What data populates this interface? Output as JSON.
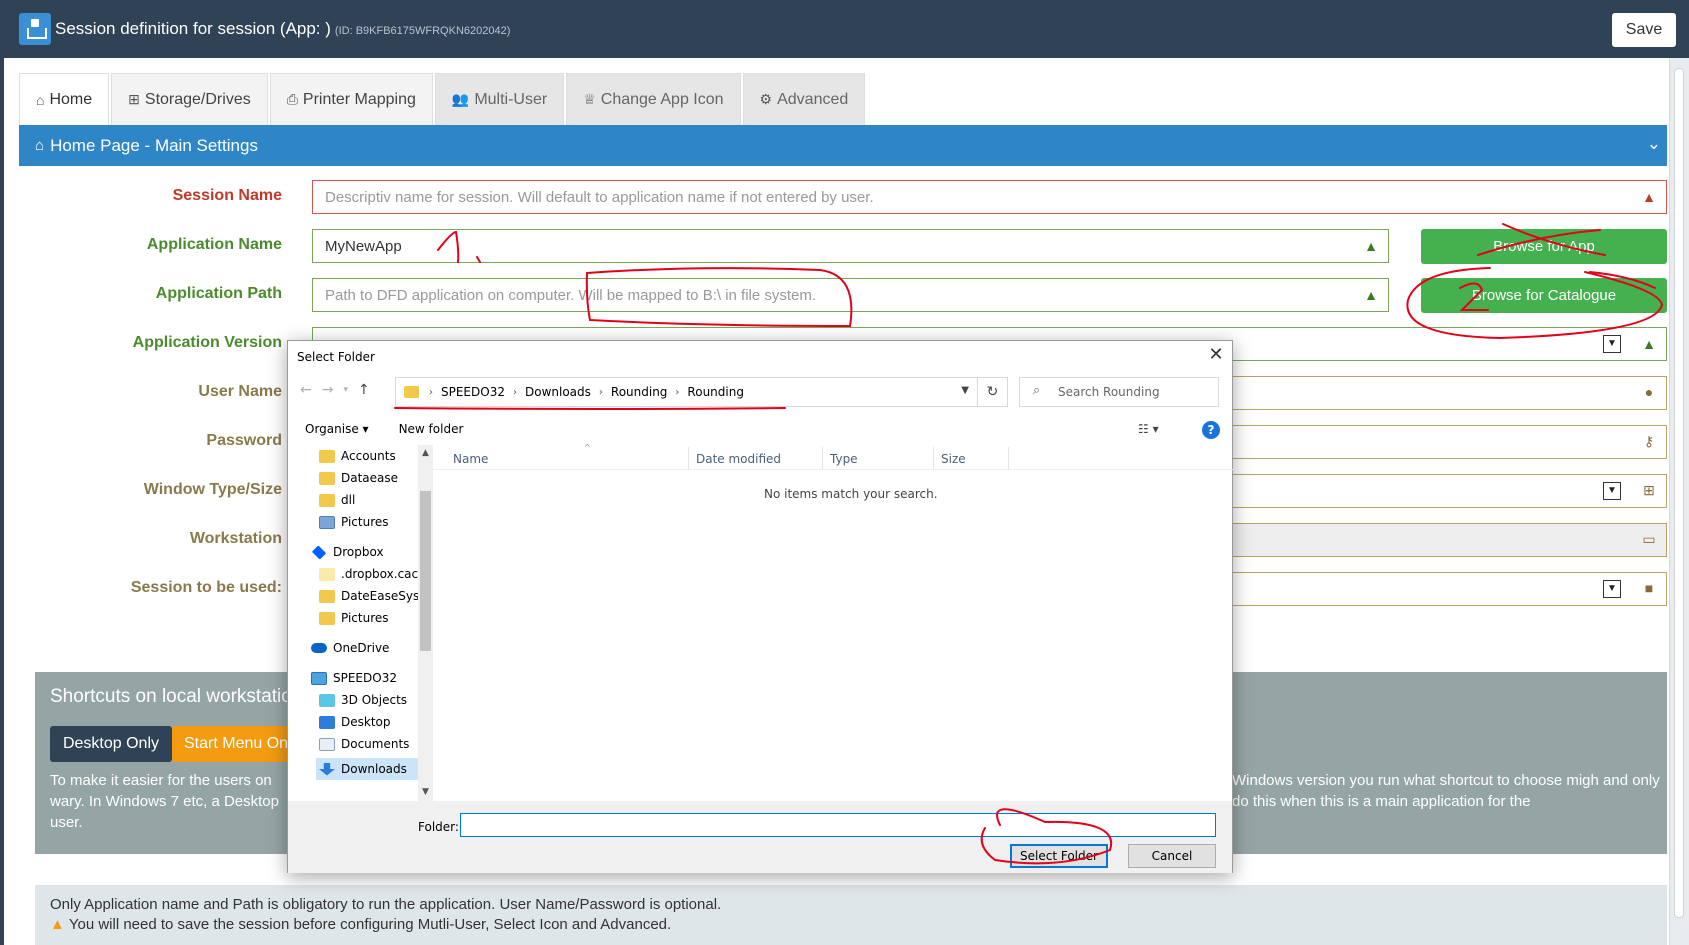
{
  "header": {
    "title": "Session definition for session (App: )",
    "id_label": "(ID: B9KFB6175WFRQKN6202042)",
    "save_label": "Save"
  },
  "tabs": [
    {
      "label": "Home",
      "icon": "home-icon"
    },
    {
      "label": "Storage/Drives",
      "icon": "sitemap-icon"
    },
    {
      "label": "Printer Mapping",
      "icon": "printer-icon"
    },
    {
      "label": "Multi-User",
      "icon": "users-icon"
    },
    {
      "label": "Change App Icon",
      "icon": "trophy-icon"
    },
    {
      "label": "Advanced",
      "icon": "gears-icon"
    }
  ],
  "section": {
    "title": "Home Page - Main Settings"
  },
  "form": {
    "session_name": {
      "label": "Session Name",
      "placeholder": "Descriptiv name for session. Will default to application name if not entered by user."
    },
    "application_name": {
      "label": "Application Name",
      "value": "MyNewApp"
    },
    "application_path": {
      "label": "Application Path",
      "placeholder": "Path to DFD application on computer. Will be mapped to B:\\ in file system."
    },
    "application_version": {
      "label": "Application Version"
    },
    "user_name": {
      "label": "User Name"
    },
    "password": {
      "label": "Password"
    },
    "window_type": {
      "label": "Window Type/Size"
    },
    "workstation": {
      "label": "Workstation"
    },
    "session_to_use": {
      "label": "Session to be used:"
    },
    "browse_app_label": "Browse for App",
    "browse_catalogue_label": "Browse for Catalogue"
  },
  "shortcuts": {
    "title": "Shortcuts on local workstation",
    "desktop_only": "Desktop Only",
    "start_menu": "Start Menu Only",
    "text_left": "To make it easier for the users on wary. In Windows 7 etc, a Desktop user.",
    "text_right": "Windows version you run what shortcut to choose migh and only do this when this is a main application for the"
  },
  "info": {
    "line1": "Only Application name and Path is obligatory to run the application. User Name/Password is optional.",
    "line2": "You will need to save the session before configuring Mutli-User, Select Icon and Advanced."
  },
  "dialog": {
    "title": "Select Folder",
    "breadcrumb": [
      "SPEEDO32",
      "Downloads",
      "Rounding",
      "Rounding"
    ],
    "search_placeholder": "Search Rounding",
    "organise": "Organise ▾",
    "new_folder": "New folder",
    "columns": [
      "Name",
      "Date modified",
      "Type",
      "Size"
    ],
    "empty_message": "No items match your search.",
    "tree": [
      {
        "label": "Accounts",
        "icon": "folder-icon"
      },
      {
        "label": "Dataease",
        "icon": "folder-icon"
      },
      {
        "label": "dll",
        "icon": "folder-icon"
      },
      {
        "label": "Pictures",
        "icon": "pictures-icon"
      },
      {
        "label": "Dropbox",
        "icon": "dropbox-icon"
      },
      {
        "label": ".dropbox.cache",
        "icon": "folder-icon"
      },
      {
        "label": "DateEaseSys",
        "icon": "folder-icon"
      },
      {
        "label": "Pictures",
        "icon": "folder-icon"
      },
      {
        "label": "OneDrive",
        "icon": "onedrive-icon"
      },
      {
        "label": "SPEEDO32",
        "icon": "computer-icon"
      },
      {
        "label": "3D Objects",
        "icon": "3d-objects-icon"
      },
      {
        "label": "Desktop",
        "icon": "desktop-icon"
      },
      {
        "label": "Documents",
        "icon": "documents-icon"
      },
      {
        "label": "Downloads",
        "icon": "downloads-icon"
      }
    ],
    "folder_label": "Folder:",
    "folder_value": "",
    "select_label": "Select Folder",
    "cancel_label": "Cancel"
  },
  "annotations": {
    "mark_1": "1",
    "mark_2": "2"
  }
}
